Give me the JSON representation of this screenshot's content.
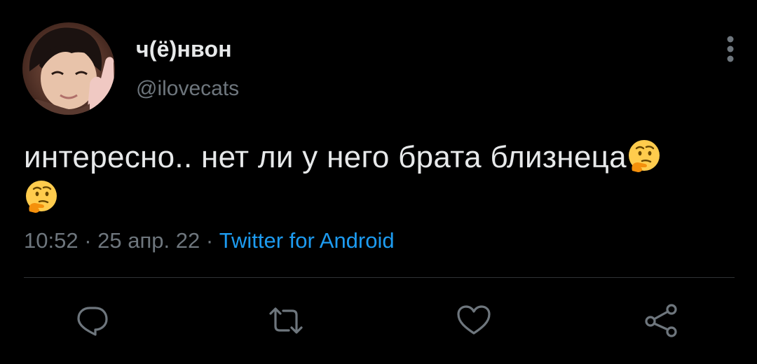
{
  "author": {
    "display_name": "ч(ё)нвон",
    "handle": "@ilovecats",
    "avatar": "avatar-photo"
  },
  "tweet": {
    "text_line1": "интересно.. нет ли у него брата близнеца",
    "emoji": "thinking-face-emoji",
    "emoji_count": 2
  },
  "meta": {
    "time": "10:52",
    "separator1": " · ",
    "date": "25 апр. 22",
    "separator2": " · ",
    "source": "Twitter for Android"
  },
  "actions": {
    "reply": "reply-icon",
    "retweet": "retweet-icon",
    "like": "heart-icon",
    "share": "share-icon",
    "more": "more-vertical-icon"
  },
  "colors": {
    "background": "#000000",
    "text": "#e7e9ea",
    "secondary": "#6e767d",
    "link": "#1d9bf0",
    "divider": "#2f3336"
  }
}
